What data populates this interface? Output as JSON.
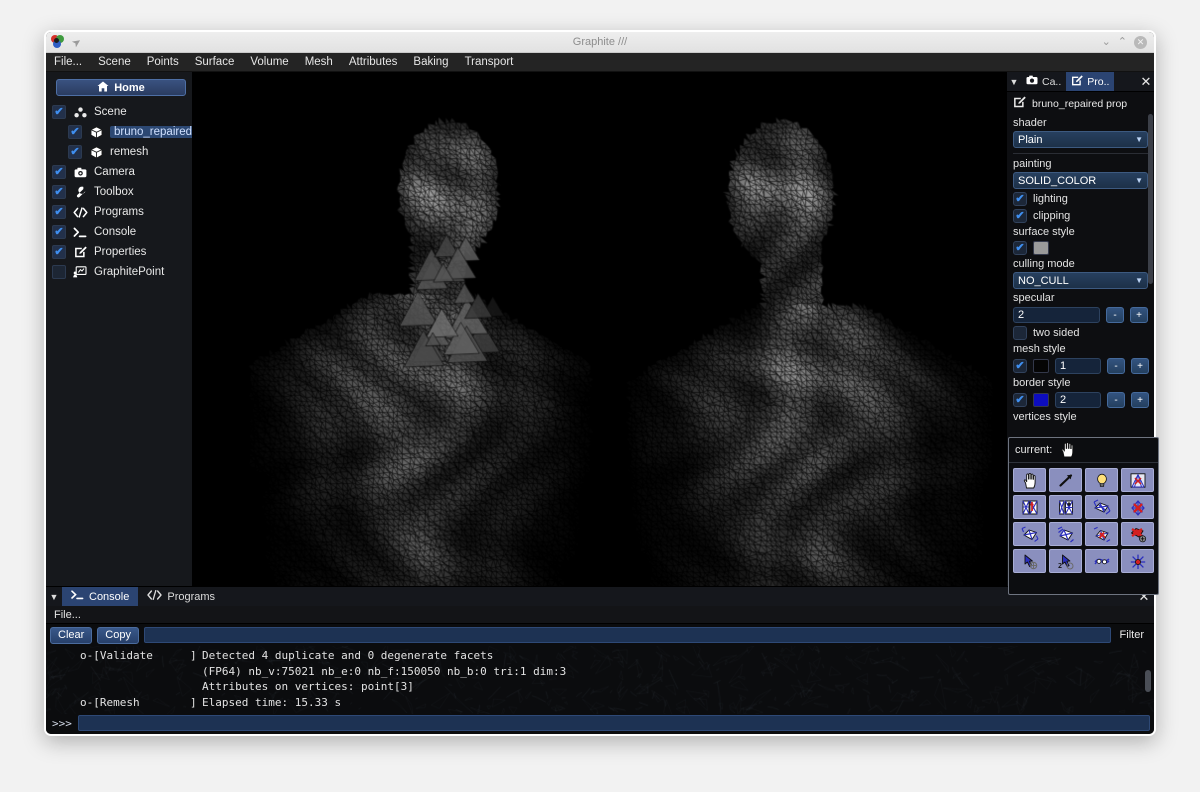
{
  "window": {
    "title": "Graphite ///",
    "logo_icon": "graphite-logo-icon",
    "pin_icon": "pin-icon",
    "minimize_label": "⌄",
    "maximize_label": "⌃",
    "close_label": "✕"
  },
  "menubar": {
    "items": [
      {
        "label": "File..."
      },
      {
        "label": "Scene"
      },
      {
        "label": "Points"
      },
      {
        "label": "Surface"
      },
      {
        "label": "Volume"
      },
      {
        "label": "Mesh"
      },
      {
        "label": "Attributes"
      },
      {
        "label": "Baking"
      },
      {
        "label": "Transport"
      }
    ]
  },
  "sidebar": {
    "home_label": "Home",
    "home_icon": "home-icon",
    "items": [
      {
        "label": "Scene",
        "icon": "scene-nodes-icon",
        "checked": true,
        "indent": false,
        "selected": false
      },
      {
        "label": "bruno_repaired",
        "icon": "mesh-cube-icon",
        "checked": true,
        "indent": true,
        "selected": true
      },
      {
        "label": "remesh",
        "icon": "mesh-cube-icon",
        "checked": true,
        "indent": true,
        "selected": false
      },
      {
        "label": "Camera",
        "icon": "camera-icon",
        "checked": true,
        "indent": false,
        "selected": false
      },
      {
        "label": "Toolbox",
        "icon": "wrench-icon",
        "checked": true,
        "indent": false,
        "selected": false
      },
      {
        "label": "Programs",
        "icon": "code-icon",
        "checked": true,
        "indent": false,
        "selected": false
      },
      {
        "label": "Console",
        "icon": "terminal-icon",
        "checked": true,
        "indent": false,
        "selected": false
      },
      {
        "label": "Properties",
        "icon": "edit-square-icon",
        "checked": true,
        "indent": false,
        "selected": false
      },
      {
        "label": "GraphitePoint",
        "icon": "presentation-icon",
        "checked": false,
        "indent": false,
        "selected": false
      }
    ]
  },
  "viewport": {
    "background": "#000000",
    "content_description": "wireframe triangulated 3D scan of a marble bust"
  },
  "properties_panel": {
    "tabs": [
      {
        "label": "Ca..",
        "icon": "camera-icon",
        "active": false
      },
      {
        "label": "Pro..",
        "icon": "edit-square-icon",
        "active": true
      }
    ],
    "close_label": "✕",
    "caret_label": "▼",
    "header": {
      "icon": "edit-square-icon",
      "title": "bruno_repaired prop"
    },
    "shader": {
      "label": "shader",
      "value": "Plain"
    },
    "painting": {
      "label": "painting",
      "value": "SOLID_COLOR"
    },
    "lighting": {
      "label": "lighting",
      "checked": true
    },
    "clipping": {
      "label": "clipping",
      "checked": true
    },
    "surface_style": {
      "label": "surface style",
      "checked": true,
      "color": "#9a9a9a"
    },
    "culling_mode": {
      "label": "culling mode",
      "value": "NO_CULL"
    },
    "specular": {
      "label": "specular",
      "value": "2",
      "minus": "-",
      "plus": "+"
    },
    "two_sided": {
      "label": "two sided",
      "checked": false
    },
    "mesh_style": {
      "label": "mesh style",
      "checked": true,
      "color": "#050505",
      "value": "1",
      "minus": "-",
      "plus": "+"
    },
    "border_style": {
      "label": "border style",
      "checked": true,
      "color": "#0d0dbe",
      "value": "2",
      "minus": "-",
      "plus": "+"
    },
    "vertices_style": {
      "label": "vertices style"
    }
  },
  "tool_palette": {
    "current_label": "current:",
    "current_icon": "hand-cursor-icon",
    "tools": [
      {
        "name": "hand-tool-icon",
        "glyph": "hand"
      },
      {
        "name": "arrow-pick-tool-icon",
        "glyph": "arrow"
      },
      {
        "name": "light-bulb-tool-icon",
        "glyph": "bulb"
      },
      {
        "name": "mesh-select-tool-icon",
        "glyph": "meshsel"
      },
      {
        "name": "paint-faces-tool-icon",
        "glyph": "paint1"
      },
      {
        "name": "paint-edges-tool-icon",
        "glyph": "paint2"
      },
      {
        "name": "edge-flip-tool-icon",
        "glyph": "edgeflip"
      },
      {
        "name": "vertex-delete-tool-icon",
        "glyph": "vdelete"
      },
      {
        "name": "facet-select-tool-icon",
        "glyph": "facetsel"
      },
      {
        "name": "facet-split-tool-icon",
        "glyph": "facetsplit"
      },
      {
        "name": "facet-paint-tool-icon",
        "glyph": "facetpaint"
      },
      {
        "name": "facet-remove-tool-icon",
        "glyph": "facetremove"
      },
      {
        "name": "vertex-move-tool-icon",
        "glyph": "vmove"
      },
      {
        "name": "vertex-move2-tool-icon",
        "glyph": "vmove2"
      },
      {
        "name": "edge-collapse-tool-icon",
        "glyph": "ecollapse"
      },
      {
        "name": "vertex-highlight-tool-icon",
        "glyph": "vhighlight"
      }
    ]
  },
  "console_dock": {
    "tabs": [
      {
        "label": "Console",
        "icon": "terminal-icon",
        "active": true
      },
      {
        "label": "Programs",
        "icon": "code-icon",
        "active": false
      }
    ],
    "caret_label": "▼",
    "close_label": "✕",
    "file_menu_label": "File...",
    "clear_label": "Clear",
    "copy_label": "Copy",
    "filter_label": "Filter",
    "filter_value": "",
    "prompt_caret": ">>>",
    "prompt_value": "",
    "log_lines": [
      {
        "tag": "o-[Validate",
        "close": "]",
        "text": "Detected 4 duplicate and 0 degenerate facets"
      },
      {
        "tag": "",
        "close": "",
        "text": "(FP64) nb_v:75021 nb_e:0 nb_f:150050 nb_b:0 tri:1 dim:3"
      },
      {
        "tag": "",
        "close": "",
        "text": "Attributes on vertices: point[3]"
      },
      {
        "tag": "o-[Remesh",
        "close": "]",
        "text": "Elapsed time: 15.33 s"
      }
    ]
  },
  "colors": {
    "accent_blue": "#2b4472",
    "check_blue": "#3f8ff0",
    "panel_dark": "#0d0e11",
    "sidebar_dark": "#16181c",
    "desktop": "#f2f2f2"
  }
}
